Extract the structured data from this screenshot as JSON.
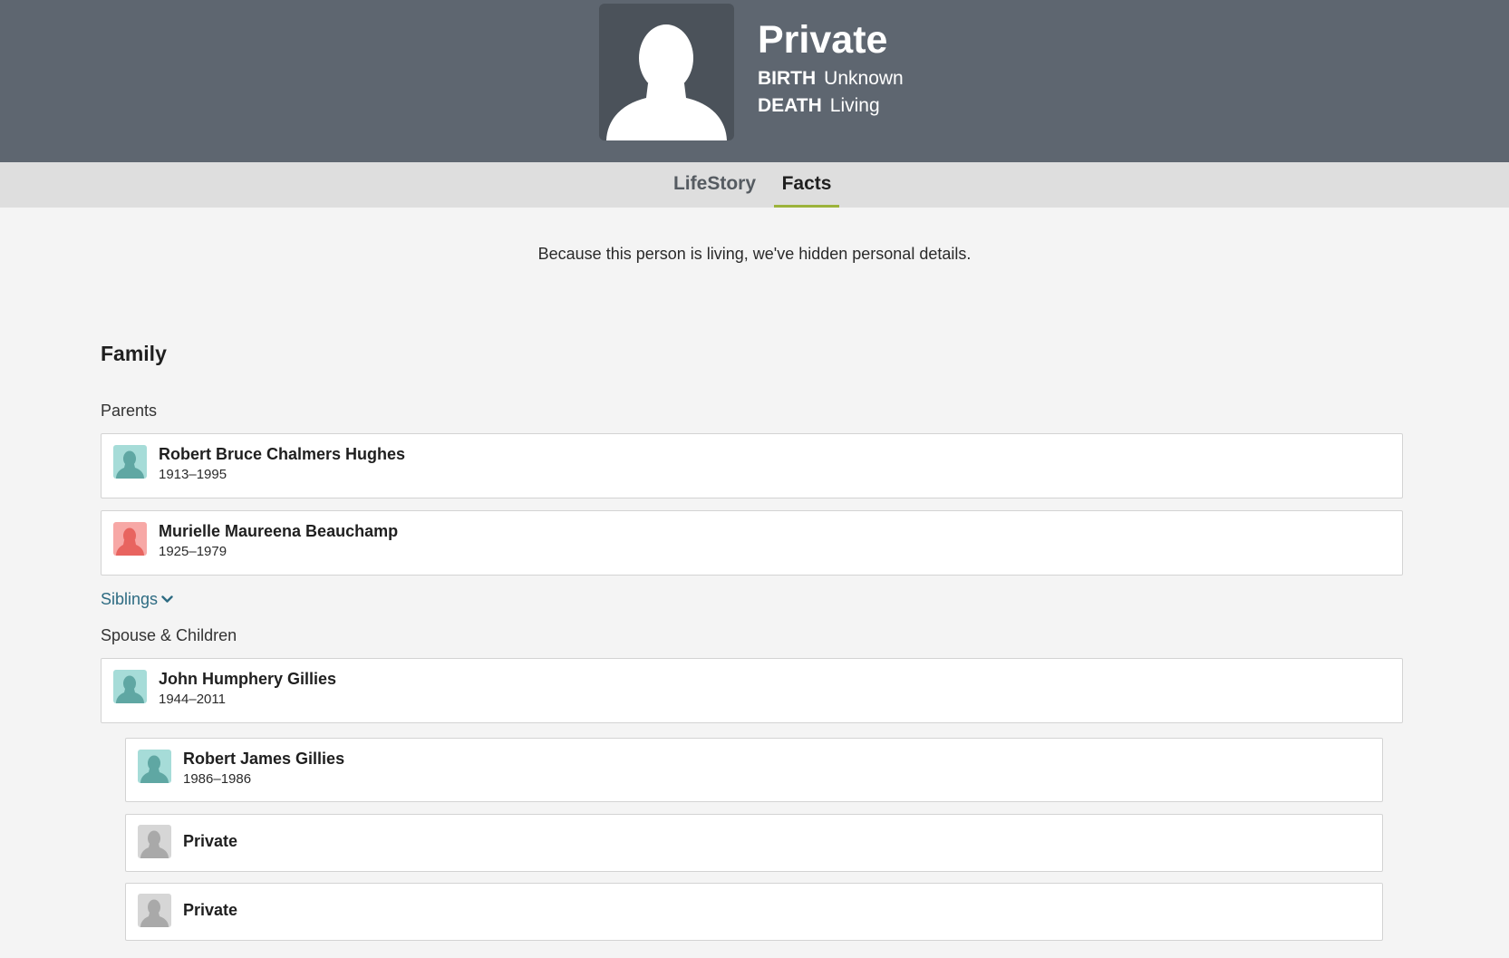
{
  "header": {
    "name": "Private",
    "birth": {
      "label": "BIRTH",
      "value": "Unknown"
    },
    "death": {
      "label": "DEATH",
      "value": "Living"
    },
    "photo_icon": "silhouette-icon"
  },
  "tabs": [
    {
      "label": "LifeStory",
      "active": false
    },
    {
      "label": "Facts",
      "active": true
    }
  ],
  "notice": "Because this person is living, we've hidden personal details.",
  "family": {
    "heading": "Family",
    "parents_label": "Parents",
    "parents": [
      {
        "name": "Robert Bruce Chalmers Hughes",
        "dates": "1913–1995",
        "gender": "male"
      },
      {
        "name": "Murielle Maureena Beauchamp",
        "dates": "1925–1979",
        "gender": "female"
      }
    ],
    "siblings_label": "Siblings",
    "spouse_children_label": "Spouse & Children",
    "spouse": {
      "name": "John Humphery Gillies",
      "dates": "1944–2011",
      "gender": "male"
    },
    "children": [
      {
        "name": "Robert James Gillies",
        "dates": "1986–1986",
        "gender": "male"
      },
      {
        "name": "Private",
        "dates": "",
        "gender": "unknown"
      },
      {
        "name": "Private",
        "dates": "",
        "gender": "unknown"
      }
    ]
  },
  "colors": {
    "header_bg": "#5e6670",
    "tab_active_underline": "#9cb33b",
    "link": "#2d6b82",
    "male_avatar": "#a6dcd8",
    "female_avatar": "#f7a8a6",
    "unknown_avatar": "#d6d6d6"
  }
}
